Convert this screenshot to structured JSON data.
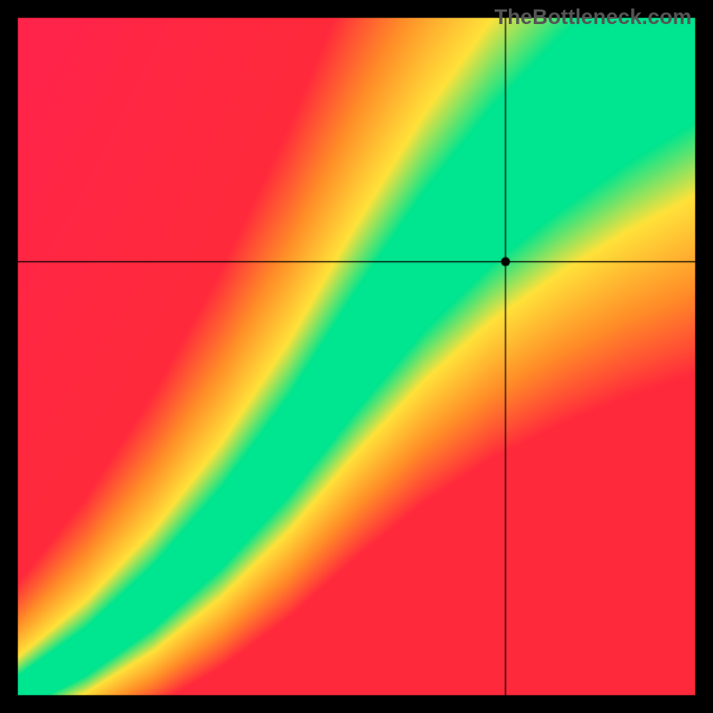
{
  "watermark": "TheBottleneck.com",
  "canvas_size": 800,
  "border_width": 20,
  "crosshair": {
    "x_frac": 0.72,
    "y_frac": 0.36
  },
  "chart_data": {
    "type": "heatmap",
    "title": "",
    "xlabel": "",
    "ylabel": "",
    "xlim": [
      0,
      1
    ],
    "ylim": [
      0,
      1
    ],
    "description": "Red-yellow-green heatmap of CPU/GPU balance. Green diagonal ridge = balanced; red regions = bottleneck. Crosshair marks the evaluated CPU/GPU pair.",
    "point": {
      "x": 0.72,
      "y": 0.64
    },
    "ridge_points": [
      {
        "xn": 0.0,
        "yn": 0.0
      },
      {
        "xn": 0.1,
        "yn": 0.06
      },
      {
        "xn": 0.2,
        "yn": 0.14
      },
      {
        "xn": 0.3,
        "yn": 0.24
      },
      {
        "xn": 0.4,
        "yn": 0.36
      },
      {
        "xn": 0.5,
        "yn": 0.5
      },
      {
        "xn": 0.6,
        "yn": 0.63
      },
      {
        "xn": 0.7,
        "yn": 0.74
      },
      {
        "xn": 0.8,
        "yn": 0.83
      },
      {
        "xn": 0.9,
        "yn": 0.91
      },
      {
        "xn": 1.0,
        "yn": 0.98
      }
    ],
    "colors": {
      "ridge": "#00e58f",
      "mid": "#ffe23a",
      "far": "#ff2a3c"
    }
  }
}
